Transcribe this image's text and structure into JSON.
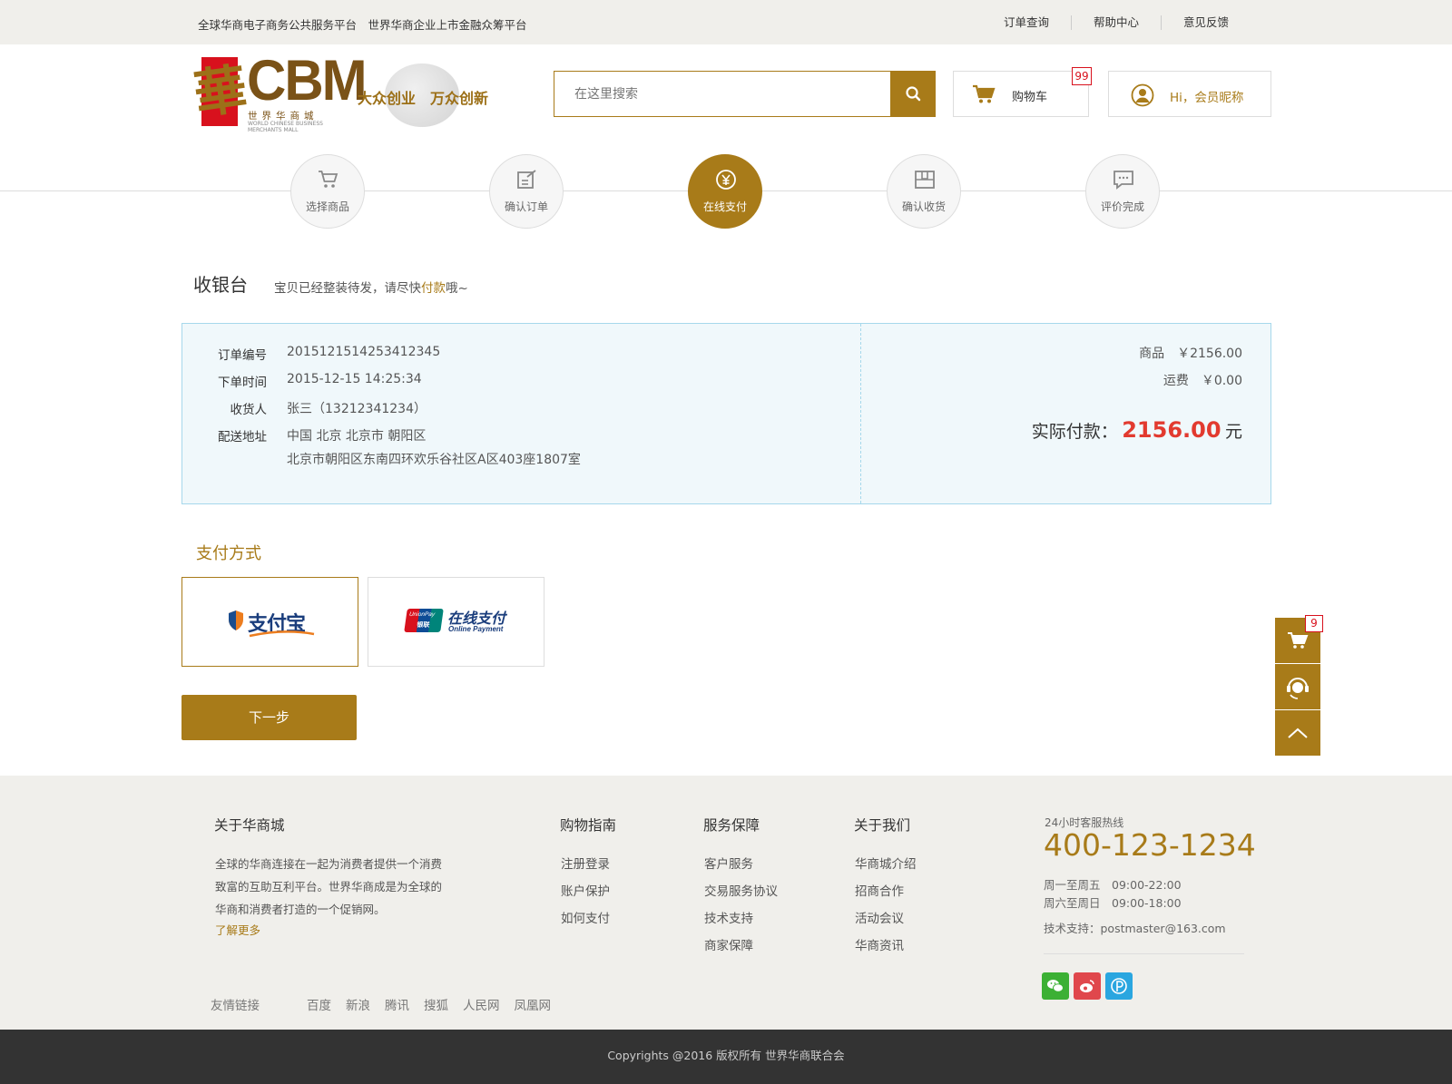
{
  "topbar": {
    "slogan": "全球华商电子商务公共服务平台　世界华商企业上市金融众筹平台",
    "links": [
      "订单查询",
      "帮助中心",
      "意见反馈"
    ]
  },
  "logo": {
    "glyph": "華",
    "brand": "CBM",
    "cn": "世界华商城",
    "en": "WORLD CHINESE BUSINESS MERCHANTS MALL",
    "motto": "大众创业　万众创新"
  },
  "search": {
    "placeholder": "在这里搜索"
  },
  "cart": {
    "label": "购物车",
    "count": "99"
  },
  "user": {
    "label": "Hi，会员昵称"
  },
  "steps": [
    "选择商品",
    "确认订单",
    "在线支付",
    "确认收货",
    "评价完成"
  ],
  "cashier": {
    "title": "收银台",
    "sub_before": "宝贝已经整装待发，请尽快",
    "sub_highlight": "付款",
    "sub_after": "哦~"
  },
  "order": {
    "labels": {
      "no": "订单编号",
      "time": "下单时间",
      "receiver": "收货人",
      "address": "配送地址"
    },
    "no": "2015121514253412345",
    "time": "2015-12-15 14:25:34",
    "receiver": "张三（13212341234）",
    "address_line1": "中国 北京 北京市 朝阳区",
    "address_line2": "北京市朝阳区东南四环欢乐谷社区A区403座1807室",
    "goods_label": "商品",
    "goods_value": "￥2156.00",
    "freight_label": "运费",
    "freight_value": "￥0.00",
    "actual_label": "实际付款：",
    "actual_value": "2156.00",
    "actual_unit": "元"
  },
  "payment": {
    "title": "支付方式",
    "alipay": "支付宝",
    "unionpay_badge_top": "UnionPay",
    "unionpay_badge_bottom": "银联",
    "unionpay_cn": "在线支付",
    "unionpay_en": "Online Payment",
    "next": "下一步"
  },
  "sidebar": {
    "cart_count": "9"
  },
  "footer": {
    "about": {
      "title": "关于华商城",
      "text": "全球的华商连接在一起为消费者提供一个消费致富的互助互利平台。世界华商成是为全球的华商和消费者打造的一个促销网。",
      "more": "了解更多"
    },
    "cols": [
      {
        "title": "购物指南",
        "items": [
          "注册登录",
          "账户保护",
          "如何支付"
        ]
      },
      {
        "title": "服务保障",
        "items": [
          "客户服务",
          "交易服务协议",
          "技术支持",
          "商家保障"
        ]
      },
      {
        "title": "关于我们",
        "items": [
          "华商城介绍",
          "招商合作",
          "活动会议",
          "华商资讯"
        ]
      }
    ],
    "hotline": {
      "label": "24小时客服热线",
      "number": "400-123-1234",
      "weekday": "周一至周五　09:00-22:00",
      "weekend": "周六至周日　09:00-18:00",
      "support": "技术支持：postmaster@163.com"
    },
    "friends": {
      "label": "友情链接",
      "links": [
        "百度",
        "新浪",
        "腾讯",
        "搜狐",
        "人民网",
        "凤凰网"
      ]
    },
    "copyright": "Copyrights @2016  版权所有 世界华商联合会"
  },
  "colors": {
    "accent": "#a87b19",
    "price": "#e23a2f",
    "order_bg": "#f0f8fb",
    "order_border": "#a6d8eb"
  }
}
